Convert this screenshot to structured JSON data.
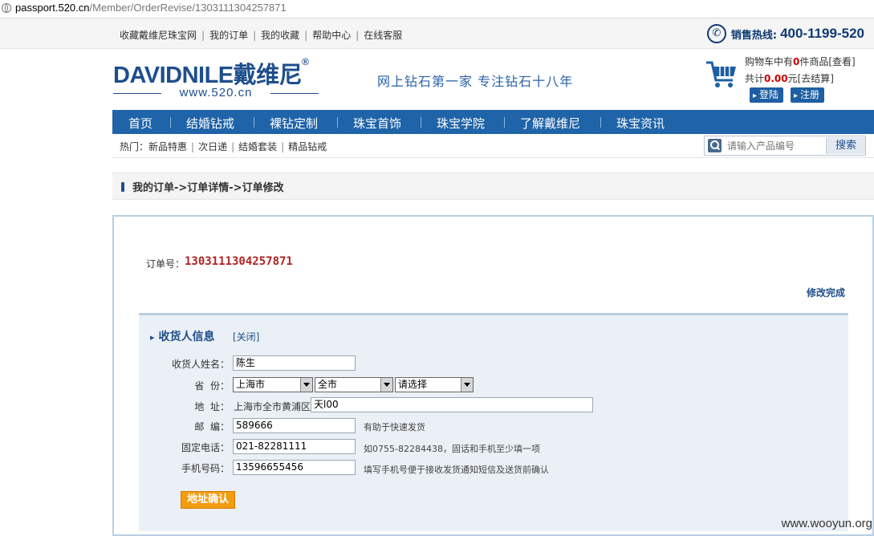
{
  "browser": {
    "url_domain": "passport.520.cn",
    "url_path": "/Member/OrderRevise/1303111304257871"
  },
  "toplinks": [
    "收藏戴维尼珠宝网",
    "我的订单",
    "我的收藏",
    "帮助中心",
    "在线客服"
  ],
  "hotline": {
    "label": "销售热线:",
    "number": "400-1199-520",
    "icon": "phone-icon"
  },
  "logo": {
    "brand_en": "DAVIDNILE",
    "brand_cn": "戴维尼",
    "reg": "®",
    "site": "www.520.cn"
  },
  "slogan": "网上钻石第一家 专注钻石十八年",
  "cart": {
    "line1_prefix": "购物车中有",
    "count": "0",
    "line1_suffix": "件商品[查看]",
    "line2_prefix": "共计",
    "total": "0.00",
    "line2_suffix": "元[去结算]",
    "login": "登陆",
    "register": "注册",
    "icon": "cart-icon"
  },
  "nav": [
    "首页",
    "结婚钻戒",
    "裸钻定制",
    "珠宝首饰",
    "珠宝学院",
    "了解戴维尼",
    "珠宝资讯"
  ],
  "hotbar": {
    "label": "热门：",
    "items": [
      "新品特惠",
      "次日递",
      "结婚套装",
      "精品钻戒"
    ]
  },
  "search": {
    "placeholder": "请输入产品编号",
    "button": "搜索"
  },
  "breadcrumb": "我的订单->订单详情->订单修改",
  "order": {
    "label": "订单号：",
    "number": "1303111304257871",
    "done": "修改完成"
  },
  "recipient": {
    "title": "收货人信息",
    "close": "[关闭]",
    "name_label": "收货人姓名：",
    "name": "陈生",
    "province_label": "省  份：",
    "province": "上海市",
    "city": "全市",
    "district": "请选择",
    "address_label": "地  址：",
    "address_prefix": "上海市全市黄浦区",
    "address": "天l00",
    "zip_label": "邮  编：",
    "zip": "589666",
    "zip_hint": "有助于快速发货",
    "phone_label": "固定电话：",
    "phone": "021-82281111",
    "phone_hint": "如0755-82284438，固话和手机至少填一项",
    "mobile_label": "手机号码：",
    "mobile": "13596655456",
    "mobile_hint": "填写手机号便于接收发货通知短信及送货前确认",
    "confirm": "地址确认"
  },
  "watermark": "www.wooyun.org"
}
